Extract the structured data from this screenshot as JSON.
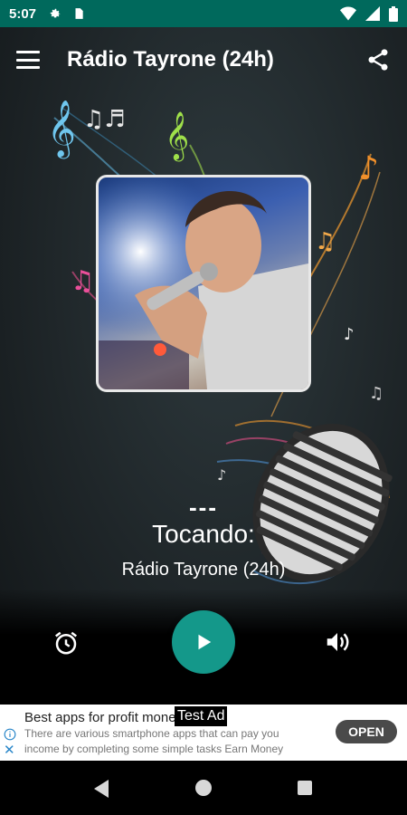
{
  "status_bar": {
    "time": "5:07",
    "icons": [
      "gear-icon",
      "sim-card-icon",
      "wifi-icon",
      "signal-icon",
      "battery-icon"
    ],
    "color": "#00695c"
  },
  "app_bar": {
    "title": "Rádio Tayrone (24h)",
    "menu_icon": "hamburger-menu-icon",
    "share_icon": "share-icon"
  },
  "player": {
    "track_placeholder": "---",
    "status_label": "Tocando:",
    "station_name": "Rádio Tayrone (24h)",
    "alarm_icon": "alarm-clock-icon",
    "play_icon": "play-icon",
    "volume_icon": "volume-icon",
    "accent_color": "#14988a"
  },
  "ad": {
    "tag": "Test Ad",
    "title": "Best apps for profit mone",
    "description": "There are various smartphone apps that can pay you income by completing some simple tasks Earn Money",
    "cta": "OPEN"
  },
  "nav_bar": {
    "icons": [
      "back-icon",
      "home-icon",
      "recents-icon"
    ]
  }
}
